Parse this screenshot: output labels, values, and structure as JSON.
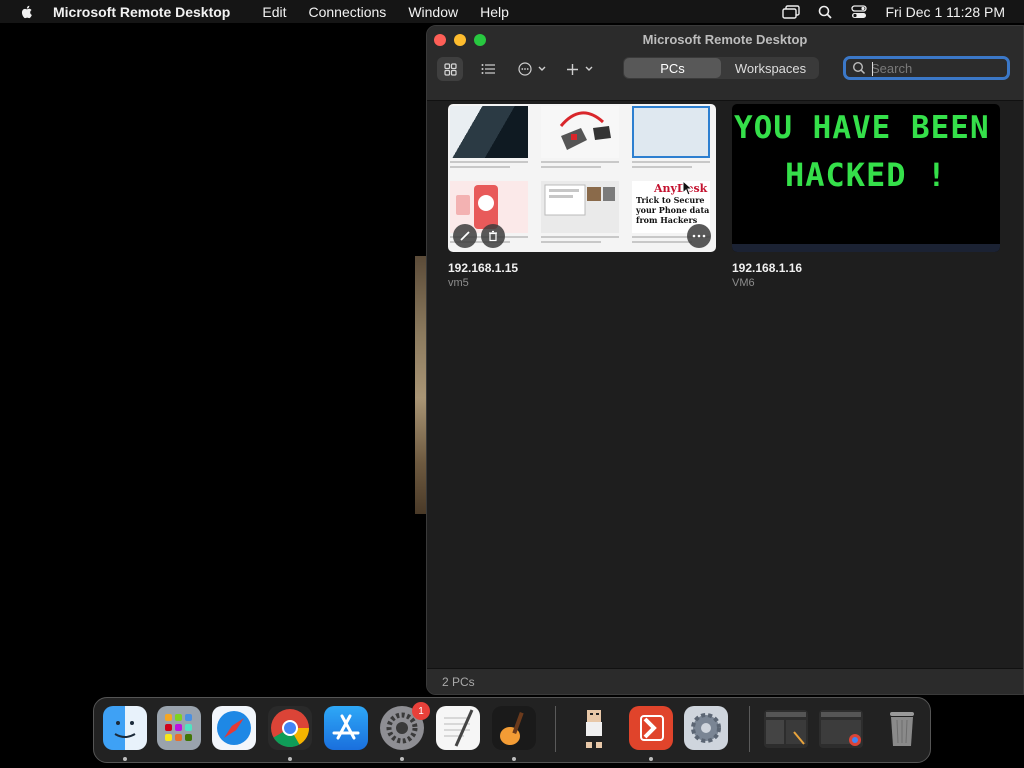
{
  "menubar": {
    "app_name": "Microsoft Remote Desktop",
    "items": [
      "Edit",
      "Connections",
      "Window",
      "Help"
    ],
    "clock": "Fri Dec 1  11:28 PM"
  },
  "window": {
    "title": "Microsoft Remote Desktop",
    "tabs": [
      {
        "label": "PCs",
        "active": true
      },
      {
        "label": "Workspaces",
        "active": false
      }
    ],
    "search_placeholder": "Search",
    "status": "2 PCs"
  },
  "pcs": [
    {
      "name": "192.168.1.15",
      "friendly": "vm5"
    },
    {
      "name": "192.168.1.16",
      "friendly": "VM6"
    }
  ],
  "thumb1": {
    "tile_text": {
      "anydesk_logo": "AnyDesk",
      "promo": "Trick to Secure your Phone data from Hackers"
    }
  },
  "thumb2": {
    "line1": "YOU HAVE BEEN",
    "line2": "HACKED !"
  },
  "dock": {
    "items": [
      "finder-icon",
      "launchpad-icon",
      "safari-icon",
      "chrome-icon",
      "app-store-icon",
      "system-settings-icon",
      "textedit-icon",
      "garageband-icon",
      "game-character-icon",
      "remote-desktop-icon",
      "settings-gear-icon",
      "window-preview-1",
      "window-preview-2",
      "trash-icon"
    ],
    "settings_badge": "1"
  },
  "colors": {
    "accent": "#3b78c8",
    "hacked_text": "#35e04a",
    "remote_desktop": "#e0442b"
  }
}
